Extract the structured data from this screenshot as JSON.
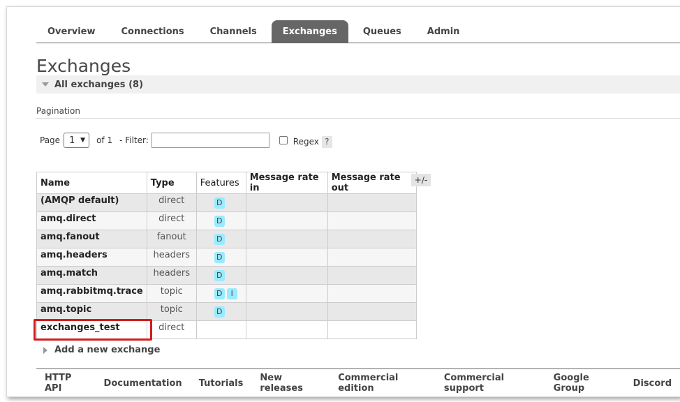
{
  "nav": {
    "tabs": [
      {
        "label": "Overview",
        "active": false
      },
      {
        "label": "Connections",
        "active": false
      },
      {
        "label": "Channels",
        "active": false
      },
      {
        "label": "Exchanges",
        "active": true
      },
      {
        "label": "Queues",
        "active": false
      },
      {
        "label": "Admin",
        "active": false
      }
    ]
  },
  "page": {
    "title": "Exchanges",
    "section_title": "All exchanges (8)"
  },
  "pagination": {
    "label": "Pagination",
    "page_label": "Page",
    "page_value": "1",
    "of_label": "of 1",
    "filter_label": "- Filter:",
    "filter_value": "",
    "regex_label": "Regex",
    "help_label": "?"
  },
  "table": {
    "headers": [
      "Name",
      "Type",
      "Features",
      "Message rate in",
      "Message rate out"
    ],
    "toggle_label": "+/-",
    "rows": [
      {
        "name": "(AMQP default)",
        "type": "direct",
        "features": [
          "D"
        ],
        "rate_in": "",
        "rate_out": ""
      },
      {
        "name": "amq.direct",
        "type": "direct",
        "features": [
          "D"
        ],
        "rate_in": "",
        "rate_out": ""
      },
      {
        "name": "amq.fanout",
        "type": "fanout",
        "features": [
          "D"
        ],
        "rate_in": "",
        "rate_out": ""
      },
      {
        "name": "amq.headers",
        "type": "headers",
        "features": [
          "D"
        ],
        "rate_in": "",
        "rate_out": ""
      },
      {
        "name": "amq.match",
        "type": "headers",
        "features": [
          "D"
        ],
        "rate_in": "",
        "rate_out": ""
      },
      {
        "name": "amq.rabbitmq.trace",
        "type": "topic",
        "features": [
          "D",
          "I"
        ],
        "rate_in": "",
        "rate_out": ""
      },
      {
        "name": "amq.topic",
        "type": "topic",
        "features": [
          "D"
        ],
        "rate_in": "",
        "rate_out": ""
      },
      {
        "name": "exchanges_test",
        "type": "direct",
        "features": [],
        "rate_in": "",
        "rate_out": ""
      }
    ]
  },
  "add_exchange": {
    "label": "Add a new exchange"
  },
  "footer": {
    "links": [
      "HTTP API",
      "Documentation",
      "Tutorials",
      "New releases",
      "Commercial edition",
      "Commercial support",
      "Google Group",
      "Discord"
    ]
  },
  "colors": {
    "active_tab": "#666666",
    "feature_badge": "#99ebff",
    "highlight_border": "#d21c1c"
  }
}
